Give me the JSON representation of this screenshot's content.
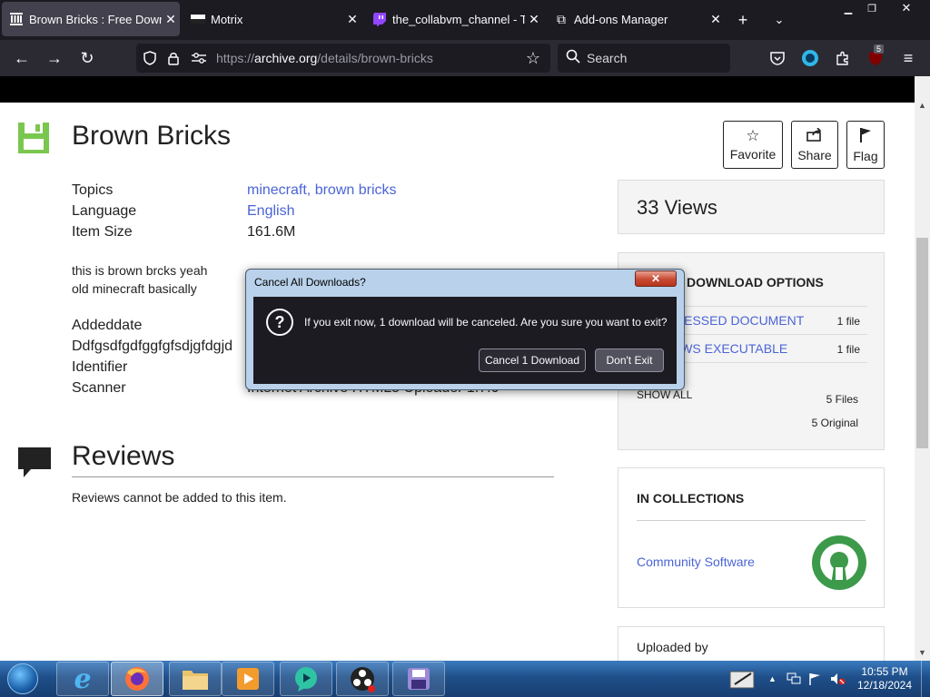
{
  "browser": {
    "tabs": [
      {
        "title": "Brown Bricks : Free Downlo",
        "active": true,
        "icon": "archive-icon"
      },
      {
        "title": "Motrix",
        "active": false,
        "icon": "motrix-icon"
      },
      {
        "title": "the_collabvm_channel - Tw",
        "active": false,
        "icon": "twitch-icon"
      },
      {
        "title": "Add-ons Manager",
        "active": false,
        "icon": "puzzle-icon"
      }
    ],
    "url_prefix": "https://",
    "url_domain": "archive.org",
    "url_path": "/details/brown-bricks",
    "search_placeholder": "Search",
    "extension_badge": "5"
  },
  "item": {
    "title": "Brown Bricks",
    "metadata": [
      {
        "label": "Topics",
        "value": "minecraft, brown bricks",
        "is_link": true
      },
      {
        "label": "Language",
        "value": "English",
        "is_link": true
      },
      {
        "label": "Item Size",
        "value": "161.6M",
        "is_link": false
      }
    ],
    "description": [
      "this is brown brcks yeah",
      "old minecraft basically"
    ],
    "metadata2": [
      "Addeddate",
      "Ddfgsdfgdfggfgfsdjgfdgjd",
      "Identifier",
      "Scanner"
    ],
    "scanner_value": "Internet Archive HTML5 Uploader 1.7.0"
  },
  "actions": {
    "favorite": "Favorite",
    "share": "Share",
    "flag": "Flag"
  },
  "views": "33 Views",
  "downloads": {
    "title": "DOWNLOAD OPTIONS",
    "rows": [
      {
        "name": "COMPRESSED DOCUMENT",
        "count": "1 file"
      },
      {
        "name": "WINDOWS EXECUTABLE",
        "count": "1 file"
      }
    ],
    "show_all": "SHOW ALL",
    "total_files": "5 Files",
    "original": "5 Original"
  },
  "collections": {
    "title": "IN COLLECTIONS",
    "link": "Community Software"
  },
  "uploaded_by": "Uploaded by",
  "reviews": {
    "title": "Reviews",
    "text": "Reviews cannot be added to this item."
  },
  "dialog": {
    "title": "Cancel All Downloads?",
    "message": "If you exit now, 1 download will be canceled. Are you sure you want to exit?",
    "cancel_label": "Cancel 1 Download",
    "stay_label": "Don't Exit"
  },
  "taskbar": {
    "time": "10:55 PM",
    "date": "12/18/2024"
  },
  "colors": {
    "link": "#4b64d6",
    "firefox_dark": "#1c1b22",
    "taskbar": "#1f4f8a"
  }
}
